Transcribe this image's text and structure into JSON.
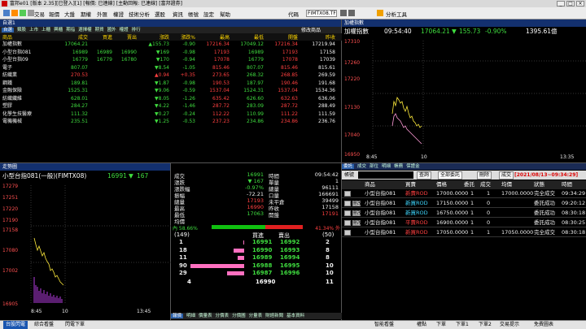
{
  "window": {
    "title": "富邦e01 [版本 2.35][已登入][1] [報價: 已連線] [主動回報: 已連線] [富邦證券]"
  },
  "menu": {
    "items": [
      "交易",
      "報價",
      "大盤",
      "期權",
      "外匯",
      "權證",
      "技術分析",
      "選股",
      "資訊",
      "帳號",
      "設定",
      "幫助"
    ],
    "code_label": "代碼",
    "code_value": "FIMTX08.TF",
    "analysis_tools": "分析工具"
  },
  "quote_panel": {
    "title": "自選1",
    "tabs": [
      "自選",
      "類股",
      "上市",
      "上櫃",
      "興櫃",
      "期指",
      "選擇權",
      "期貨",
      "國外",
      "權證",
      "排行"
    ],
    "active_tab": "自選",
    "edit_label": "修改商品",
    "headers": [
      "商品",
      "成交",
      "買進",
      "賣出",
      "漲跌",
      "漲跌%",
      "最高",
      "最低",
      "開盤",
      "昨收"
    ],
    "rows": [
      {
        "name": "加權指數",
        "last": "17064.21",
        "bid": "",
        "ask": "",
        "chg": "▲155.73",
        "pct": "-0.90",
        "high": "17216.34",
        "low": "17049.12",
        "open": "17216.34",
        "prev": "17219.94",
        "dir": "dn"
      },
      {
        "name": "小型台指081",
        "last": "16989",
        "bid": "16989",
        "ask": "16990",
        "chg": "▼169",
        "pct": "-0.98",
        "high": "17193",
        "low": "16989",
        "open": "17193",
        "prev": "17158",
        "dir": "dn"
      },
      {
        "name": "小型台指09",
        "last": "16779",
        "bid": "16779",
        "ask": "16780",
        "chg": "▼170",
        "pct": "-0.94",
        "high": "17078",
        "low": "16779",
        "open": "17078",
        "prev": "17039",
        "dir": "dn"
      },
      {
        "name": "電子",
        "last": "807.07",
        "bid": "",
        "ask": "",
        "chg": "▼8.54",
        "pct": "-1.05",
        "high": "815.46",
        "low": "807.07",
        "open": "815.46",
        "prev": "815.61",
        "dir": "dn"
      },
      {
        "name": "紡織業",
        "last": "270.53",
        "bid": "",
        "ask": "",
        "chg": "▲0.94",
        "pct": "+0.35",
        "high": "273.65",
        "low": "268.32",
        "open": "268.85",
        "prev": "269.59",
        "dir": "up"
      },
      {
        "name": "鋼鐵",
        "last": "189.81",
        "bid": "",
        "ask": "",
        "chg": "▼1.87",
        "pct": "-0.98",
        "high": "190.53",
        "low": "187.97",
        "open": "190.46",
        "prev": "191.68",
        "dir": "dn"
      },
      {
        "name": "金融保險",
        "last": "1525.31",
        "bid": "",
        "ask": "",
        "chg": "▼9.06",
        "pct": "-0.59",
        "high": "1537.04",
        "low": "1524.31",
        "open": "1537.04",
        "prev": "1534.36",
        "dir": "dn"
      },
      {
        "name": "紡織纖維",
        "last": "628.01",
        "bid": "",
        "ask": "",
        "chg": "▼8.05",
        "pct": "-1.26",
        "high": "635.42",
        "low": "626.60",
        "open": "632.63",
        "prev": "636.06",
        "dir": "dn"
      },
      {
        "name": "塑膠",
        "last": "284.27",
        "bid": "",
        "ask": "",
        "chg": "▼4.22",
        "pct": "-1.46",
        "high": "287.72",
        "low": "283.09",
        "open": "287.72",
        "prev": "288.49",
        "dir": "dn"
      },
      {
        "name": "化學生技醫療",
        "last": "111.32",
        "bid": "",
        "ask": "",
        "chg": "▼0.27",
        "pct": "-0.24",
        "high": "112.22",
        "low": "110.99",
        "open": "111.22",
        "prev": "111.59",
        "dir": "dn"
      },
      {
        "name": "電機機械",
        "last": "235.51",
        "bid": "",
        "ask": "",
        "chg": "▼1.25",
        "pct": "-0.53",
        "high": "237.23",
        "low": "234.86",
        "open": "234.86",
        "prev": "236.76",
        "dir": "dn"
      }
    ]
  },
  "index_chart": {
    "title": "加權指數",
    "header_name": "加權指數",
    "time": "09:54:40",
    "price": "17064.21",
    "arrow": "▼",
    "change": "155.73",
    "pct": "-0.90%",
    "volume": "1395.61億",
    "y_ticks": [
      "17310",
      "17260",
      "17220",
      "17130",
      "17040",
      "16950"
    ],
    "x_ticks": [
      "8:45",
      "10",
      "13:35"
    ],
    "tabs": [
      "走勢",
      "技術",
      "分價",
      "即時新聞"
    ]
  },
  "futures_chart": {
    "title": "走勢圖",
    "tabs": [
      "走勢",
      "技術分析"
    ],
    "name": "小型台指081(一般)(FIMTX08)",
    "price": "16991",
    "arrow": "▼",
    "change": "167",
    "y_ticks": [
      "17279",
      "17251",
      "17220",
      "17190",
      "17158",
      "17080",
      "17002",
      "16905"
    ],
    "x_ticks": [
      "8:45",
      "10",
      "13:45"
    ],
    "bottom_tabs": [
      "報價",
      "明細",
      "價量表",
      "分價表",
      "分價圖",
      "分量表",
      "財經新聞",
      "基本資料"
    ]
  },
  "details": {
    "left_labels": [
      "成交",
      "漲跌",
      "漲跌幅",
      "振幅",
      "總量",
      "最高",
      "最低",
      "均價"
    ],
    "left_values": [
      "16991",
      "▼ 167",
      "-0.97%",
      "-72.21",
      "17193",
      "16990",
      "17063",
      ""
    ],
    "right_labels": [
      "時間",
      "單量",
      "總量",
      "口量",
      "未平倉",
      "昨收",
      "開盤",
      ""
    ],
    "right_values": [
      "09:54:42",
      "1",
      "96111",
      "166691",
      "39499",
      "17158",
      "17191",
      ""
    ],
    "in_pct": "內 58.66%",
    "out_pct": "41.34% 外",
    "in_fraction": 0.5866,
    "depth_header": [
      "(149)",
      "買進",
      "賣出",
      "(50)"
    ],
    "depth": [
      {
        "bq": "1",
        "bid": "16991",
        "ask": "16992",
        "aq": "2",
        "bar": 0.02
      },
      {
        "bq": "18",
        "bid": "16990",
        "ask": "16993",
        "aq": "8",
        "bar": 0.2
      },
      {
        "bq": "11",
        "bid": "16989",
        "ask": "16994",
        "aq": "8",
        "bar": 0.12
      },
      {
        "bq": "90",
        "bid": "16988",
        "ask": "16995",
        "aq": "10",
        "bar": 1.0
      },
      {
        "bq": "29",
        "bid": "16987",
        "ask": "16996",
        "aq": "10",
        "bar": 0.32
      }
    ],
    "total_row": {
      "bq": "4",
      "mid": "16990",
      "aq": "11"
    }
  },
  "order_panel": {
    "tabs": [
      "委託",
      "成交",
      "部位",
      "明細",
      "帳務",
      "保證金"
    ],
    "account_label": "帳號",
    "query_btn": "查詢",
    "filter": "全部委託",
    "delete_btn": "刪除",
    "fill_btn": "成交",
    "range": "[2021/08/13~09:34:29]",
    "headers": [
      "商品",
      "買賣",
      "價格",
      "委託",
      "成交",
      "均價",
      "狀態",
      "時間"
    ],
    "rows": [
      {
        "action": "",
        "product": "小型台指081",
        "side": "新賣ROD",
        "price": "17000.0000",
        "qty": "1",
        "filled": "1",
        "avg": "17000.0000",
        "status": "完全成交",
        "time": "09:34:29",
        "side_color": "up"
      },
      {
        "action": "刪改",
        "product": "小型台指081",
        "side": "新買ROD",
        "price": "17150.0000",
        "qty": "1",
        "filled": "0",
        "avg": "",
        "status": "委託成功",
        "time": "09:20:12",
        "side_color": "cy"
      },
      {
        "action": "刪改",
        "product": "小型台指081",
        "side": "新買ROD",
        "price": "16750.0000",
        "qty": "1",
        "filled": "0",
        "avg": "",
        "status": "委託成功",
        "time": "08:30:18",
        "side_color": "cy"
      },
      {
        "action": "刪改",
        "product": "小型台指081",
        "side": "平賣ROD",
        "price": "16900.0000",
        "qty": "1",
        "filled": "0",
        "avg": "",
        "status": "委託成功",
        "time": "08:30:25",
        "side_color": "up"
      },
      {
        "action": "",
        "product": "小型台指081",
        "side": "新買ROD",
        "price": "17050.0000",
        "qty": "1",
        "filled": "1",
        "avg": "17050.0000",
        "status": "完全成交",
        "time": "08:30:18",
        "side_color": "up"
      }
    ]
  },
  "status_bar": {
    "items": [
      "台股閃電",
      "綜合看盤",
      "閃電下單"
    ],
    "right": [
      "智能看盤",
      "權點",
      "下單",
      "下單1",
      "下單2",
      "交易提示",
      "免費圖表"
    ]
  }
}
